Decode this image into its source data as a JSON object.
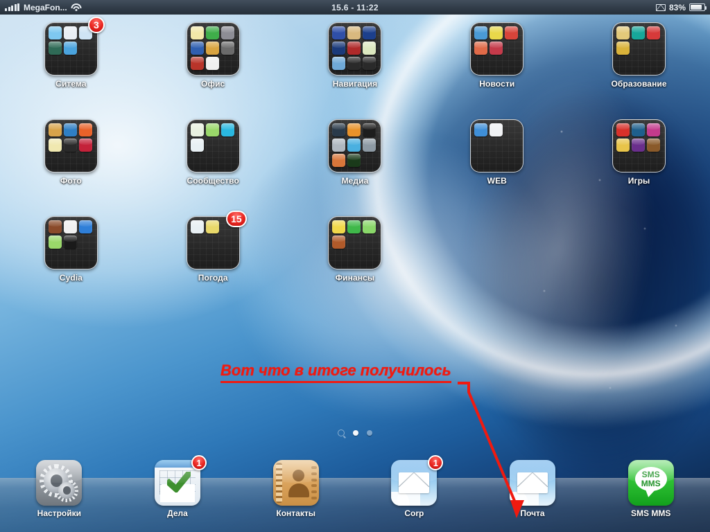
{
  "status_bar": {
    "carrier": "MegaFon...",
    "signal_icon": "signal-bars-icon",
    "wifi_icon": "wifi-icon",
    "datetime": "15.6 - 11:22",
    "mail_icon": "envelope-icon",
    "battery_percent": "83%",
    "battery_icon": "battery-icon"
  },
  "home_screen": {
    "rows": [
      [
        {
          "label": "Ситема",
          "badge": "3",
          "mini_colors": [
            "#7ec8f0",
            "#e8eef4",
            "#cfe4f4",
            "#2f6a56",
            "#4aa3dd"
          ]
        },
        {
          "label": "Офис",
          "badge": null,
          "mini_colors": [
            "#f2e8a8",
            "#3fae4a",
            "#8d8d95",
            "#2f5fb0",
            "#d9a441",
            "#6b6b6b",
            "#b8342a",
            "#f0f0f0",
            null
          ]
        },
        {
          "label": "Навигация",
          "badge": null,
          "mini_colors": [
            "#2f4fa8",
            "#d9b97f",
            "#1c3f8c",
            "#1b3a7a",
            "#b02a2a",
            "#dce8c0",
            "#6fa9d8",
            "#2a2a2a",
            "#2a2a2a"
          ]
        },
        {
          "label": "Новости",
          "badge": null,
          "mini_colors": [
            "#4a9ad6",
            "#e8d84a",
            "#d8443a",
            "#e06a48",
            "#c43a4a",
            null
          ]
        },
        {
          "label": "Образование",
          "badge": null,
          "mini_colors": [
            "#e3c97a",
            "#17a79a",
            "#d63a3a",
            "#d9b23a"
          ]
        }
      ],
      [
        {
          "label": "Фото",
          "badge": null,
          "mini_colors": [
            "#d8a34a",
            "#2f7fc4",
            "#e8622a",
            "#f0e8b0",
            "#2a2a2a",
            "#c4223a"
          ]
        },
        {
          "label": "Сообщество",
          "badge": null,
          "mini_colors": [
            "#e8f0e0",
            "#9ad86a",
            "#2ab8e0",
            "#e8f0f4"
          ]
        },
        {
          "label": "Медиа",
          "badge": null,
          "mini_colors": [
            "#2a3a4a",
            "#e8922a",
            "#1d1d1d",
            "#b0b8c0",
            "#4ab0e0",
            "#8d9aa4",
            "#d8763a",
            "#1a3a1a",
            null
          ]
        },
        {
          "label": "WEB",
          "badge": null,
          "mini_colors": [
            "#3f8fd8",
            "#f0f2f4"
          ]
        },
        {
          "label": "Игры",
          "badge": null,
          "mini_colors": [
            "#d8312a",
            "#1f5f8c",
            "#c43a8c",
            "#e8c44a",
            "#6a2f8c",
            "#8a5a2a"
          ]
        }
      ],
      [
        {
          "label": "Cydia",
          "badge": null,
          "mini_colors": [
            "#8a4a2a",
            "#f0f0f0",
            "#2f7fd8",
            "#9ad86a",
            "#1a1a1a"
          ]
        },
        {
          "label": "Погода",
          "badge": "15",
          "mini_colors": [
            "#e8f0f4",
            "#e8d86a"
          ]
        },
        {
          "label": "Финансы",
          "badge": null,
          "mini_colors": [
            "#f0d84a",
            "#3fb84a",
            "#8ad86a",
            "#b05a2a"
          ]
        },
        {
          "label": "",
          "badge": null,
          "mini_colors": []
        },
        {
          "label": "",
          "badge": null,
          "mini_colors": []
        }
      ]
    ]
  },
  "annotation": {
    "text": "Вот что в итоге получилось",
    "color": "#f01a10",
    "arrow_target": "Почта"
  },
  "page_indicator": {
    "search_icon": "search-dot-icon",
    "total_pages": 3,
    "active_page": 2
  },
  "dock": {
    "items": [
      {
        "label": "Настройки",
        "icon": "settings-gear-icon",
        "badge": null
      },
      {
        "label": "Дела",
        "icon": "tasks-checkmark-icon",
        "badge": "1"
      },
      {
        "label": "Контакты",
        "icon": "contacts-book-icon",
        "badge": null
      },
      {
        "label": "Corp",
        "icon": "mail-envelope-icon",
        "badge": "1"
      },
      {
        "label": "Почта",
        "icon": "mail-envelope-icon",
        "badge": null
      },
      {
        "label": "SMS MMS",
        "icon": "sms-bubble-icon",
        "badge": null,
        "bubble_line1": "SMS",
        "bubble_line2": "MMS"
      }
    ]
  },
  "theme": {
    "badge_red": "#e8251f",
    "annotation_red": "#f01a10",
    "label_white": "#ffffff",
    "statusbar_dark": "#313c48"
  }
}
